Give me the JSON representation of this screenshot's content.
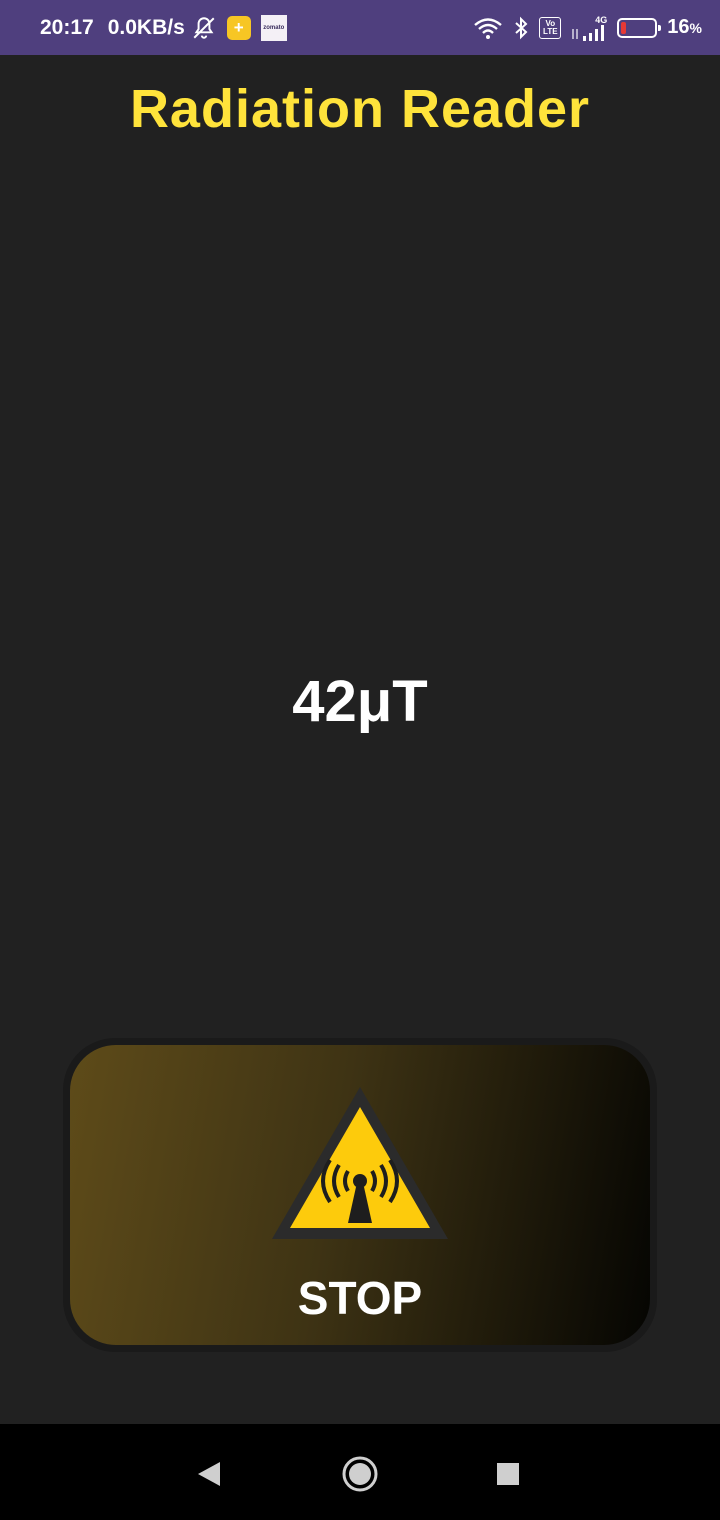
{
  "status_bar": {
    "time": "20:17",
    "net_speed": "0.0KB/s",
    "zomato_label": "zomato",
    "volte_top": "Vo",
    "volte_bottom": "LTE",
    "network_type": "4G",
    "battery_percent": "16",
    "battery_unit": "%",
    "battery_level": 0.16,
    "background_color": "#4f3f7e"
  },
  "app": {
    "title": "Radiation Reader",
    "title_color": "#ffe33b",
    "reading": "42μT",
    "stop_label": "STOP",
    "warning_color": "#fdcb0c"
  },
  "icons": {
    "mute": "bell-off-icon",
    "wifi": "wifi-icon",
    "bluetooth": "bluetooth-icon",
    "signal": "signal-icon",
    "warning": "radiation-warning-icon",
    "back": "back-icon",
    "home": "home-icon",
    "recents": "recents-icon"
  }
}
